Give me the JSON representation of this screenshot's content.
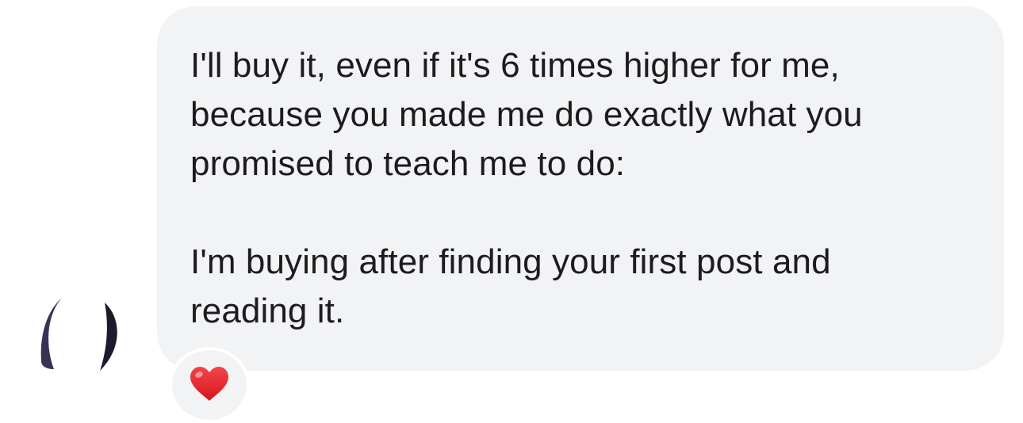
{
  "message": {
    "sender_avatar_icon": "avatar-icon",
    "paragraphs": [
      "I'll buy it, even if it's 6 times higher for me,\nbecause you made me do exactly what you\npromised to teach me to do:",
      "I'm buying after finding your first post and\nreading it."
    ],
    "bubble_color": "#f2f3f5",
    "text_color": "#1c1c1e"
  },
  "reaction": {
    "icon": "heart-icon",
    "color": "#e0242b"
  }
}
